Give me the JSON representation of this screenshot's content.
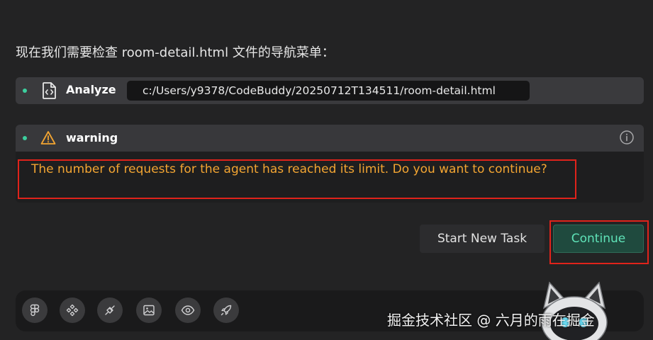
{
  "intro_text": "现在我们需要检查 room-detail.html 文件的导航菜单：",
  "analyze": {
    "label": "Analyze",
    "icon": "file-code-icon",
    "path": "c:/Users/y9378/CodeBuddy/20250712T134511/room-detail.html"
  },
  "warning": {
    "label": "warning",
    "icon": "warning-triangle-icon",
    "info_icon": "info-icon",
    "message": "The number of requests for the agent has reached its limit. Do you want to continue?"
  },
  "actions": {
    "start_new_task": "Start New Task",
    "continue": "Continue"
  },
  "toolbar": {
    "icons": [
      "figma-icon",
      "components-icon",
      "plug-icon",
      "image-icon",
      "eye-icon",
      "rocket-icon"
    ]
  },
  "watermark": "掘金技术社区 @ 六月的雨在掘金",
  "colors": {
    "accent_green": "#3ccf9e",
    "warning_orange": "#f3a532",
    "highlight_red": "#e0231b",
    "background": "#232324"
  }
}
